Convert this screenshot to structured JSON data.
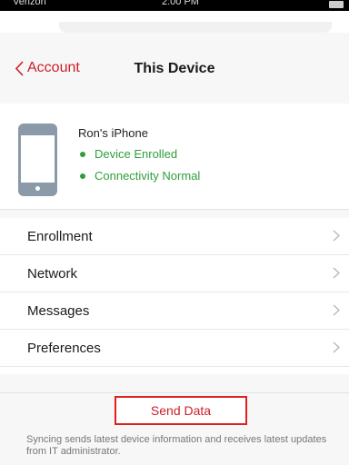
{
  "status_bar": {
    "carrier": "Verizon",
    "time": "2:00 PM"
  },
  "nav": {
    "back_label": "Account",
    "title": "This Device"
  },
  "device": {
    "name": "Ron's iPhone",
    "statuses": [
      "Device Enrolled",
      "Connectivity Normal"
    ],
    "status_color": "#2e9e3a"
  },
  "menu": [
    {
      "label": "Enrollment",
      "icon": "chevron-right-icon"
    },
    {
      "label": "Network",
      "icon": "chevron-right-icon"
    },
    {
      "label": "Messages",
      "icon": "chevron-right-icon"
    },
    {
      "label": "Preferences",
      "icon": "chevron-right-icon"
    }
  ],
  "send": {
    "label": "Send Data",
    "description": "Syncing sends latest device information and receives latest updates from IT administrator."
  },
  "colors": {
    "accent": "#cc1f28",
    "highlight_border": "#e02020"
  }
}
